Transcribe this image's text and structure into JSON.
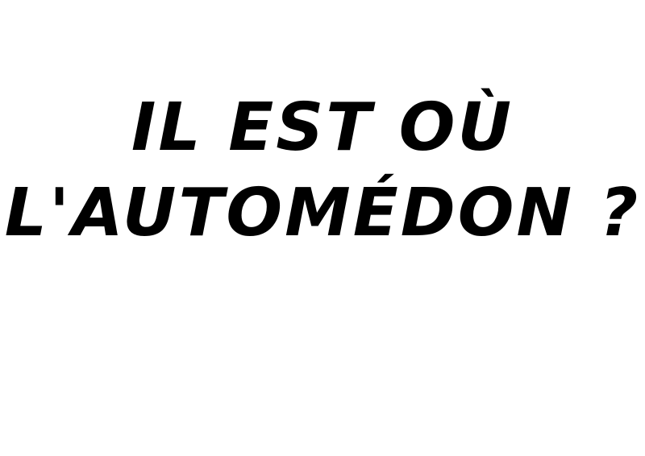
{
  "text": {
    "line1": "IL EST OÙ",
    "line2": "L'AUTOMÉDON ?"
  },
  "colors": {
    "background": "#ffffff",
    "text": "#000000"
  }
}
